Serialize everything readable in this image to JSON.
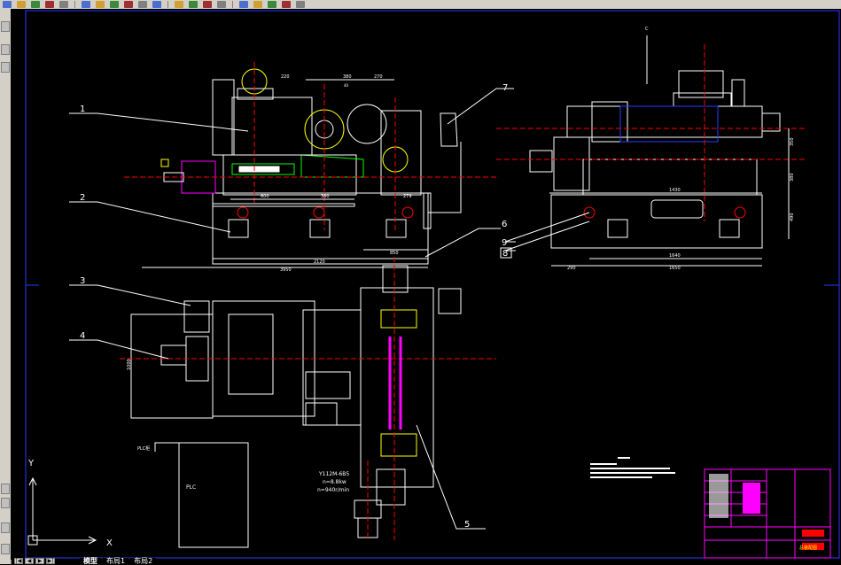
{
  "colors": {
    "background": "#000000",
    "toolbar": "#d4d0c8",
    "frame_blue": "#2a3cff",
    "line_white": "#ffffff",
    "center_red": "#ff0000",
    "accent_yellow": "#ffff00",
    "accent_green": "#00ff00",
    "accent_magenta": "#ff00ff",
    "accent_cyan": "#00ffff"
  },
  "toolbar": {
    "icons": [
      "new-icon",
      "open-icon",
      "save-icon",
      "print-icon",
      "preview-icon",
      "cut-icon",
      "copy-icon",
      "paste-icon",
      "match-icon",
      "undo-icon",
      "redo-icon",
      "pan-icon",
      "zoom-realtime-icon",
      "zoom-window-icon",
      "zoom-previous-icon",
      "properties-icon",
      "design-center-icon",
      "tool-palette-icon",
      "calculator-icon",
      "layer-icon"
    ]
  },
  "drawing": {
    "callouts": [
      "1",
      "2",
      "3",
      "4",
      "5",
      "6",
      "7",
      "8",
      "9"
    ],
    "dimensions": {
      "d220": "220",
      "d380": "380",
      "d270": "270",
      "d40": "40",
      "d600": "600",
      "d380b": "380",
      "d279": "279",
      "d850": "850",
      "d2120": "2120",
      "d3950": "3950",
      "d350": "350",
      "d380c": "380",
      "d490": "490",
      "d1640": "1640",
      "d1650": "1650",
      "d290": "290",
      "d1870": "1870",
      "d1430": "1430",
      "d1000": "1000"
    },
    "motor_spec": {
      "line1": "Y112M-6B5",
      "line2": "n=8.8kw",
      "line3": "n=940r/min"
    },
    "plc_label": "PLC",
    "plc_header": "PLC柜",
    "axis": {
      "y": "Y",
      "x": "X"
    },
    "title_block_title": "总装配图"
  },
  "tabs": {
    "items": [
      {
        "label": "模型",
        "active": true
      },
      {
        "label": "布局1",
        "active": false
      },
      {
        "label": "布局2",
        "active": false
      }
    ]
  }
}
